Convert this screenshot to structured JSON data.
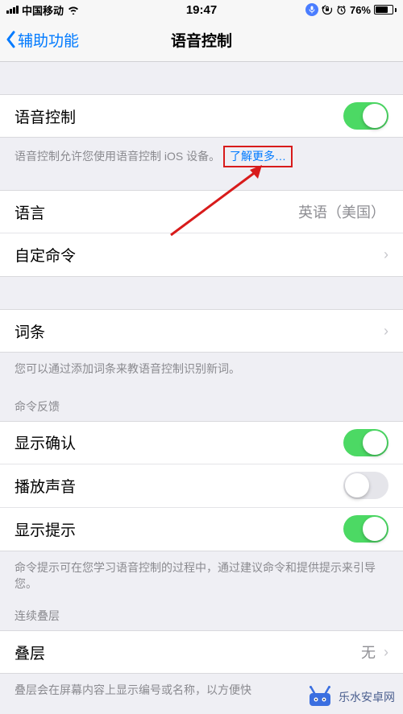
{
  "statusbar": {
    "carrier": "中国移动",
    "time": "19:47",
    "battery_pct": "76%"
  },
  "nav": {
    "back_label": "辅助功能",
    "title": "语音控制"
  },
  "voice_control": {
    "label": "语音控制",
    "on": true,
    "footer_prefix": "语音控制允许您使用语音控制 iOS 设备。",
    "learn_more": "了解更多…"
  },
  "language": {
    "label": "语言",
    "value": "英语（美国）"
  },
  "custom_commands": {
    "label": "自定命令"
  },
  "vocabulary": {
    "label": "词条",
    "footer": "您可以通过添加词条来教语音控制识别新词。"
  },
  "feedback_header": "命令反馈",
  "show_confirm": {
    "label": "显示确认",
    "on": true
  },
  "play_sound": {
    "label": "播放声音",
    "on": false
  },
  "show_hints": {
    "label": "显示提示",
    "on": true
  },
  "hints_footer": "命令提示可在您学习语音控制的过程中，通过建议命令和提供提示来引导您。",
  "overlay_header": "连续叠层",
  "overlay": {
    "label": "叠层",
    "value": "无"
  },
  "overlay_footer": "叠层会在屏幕内容上显示编号或名称，以方便快",
  "watermark": "乐水安卓网"
}
